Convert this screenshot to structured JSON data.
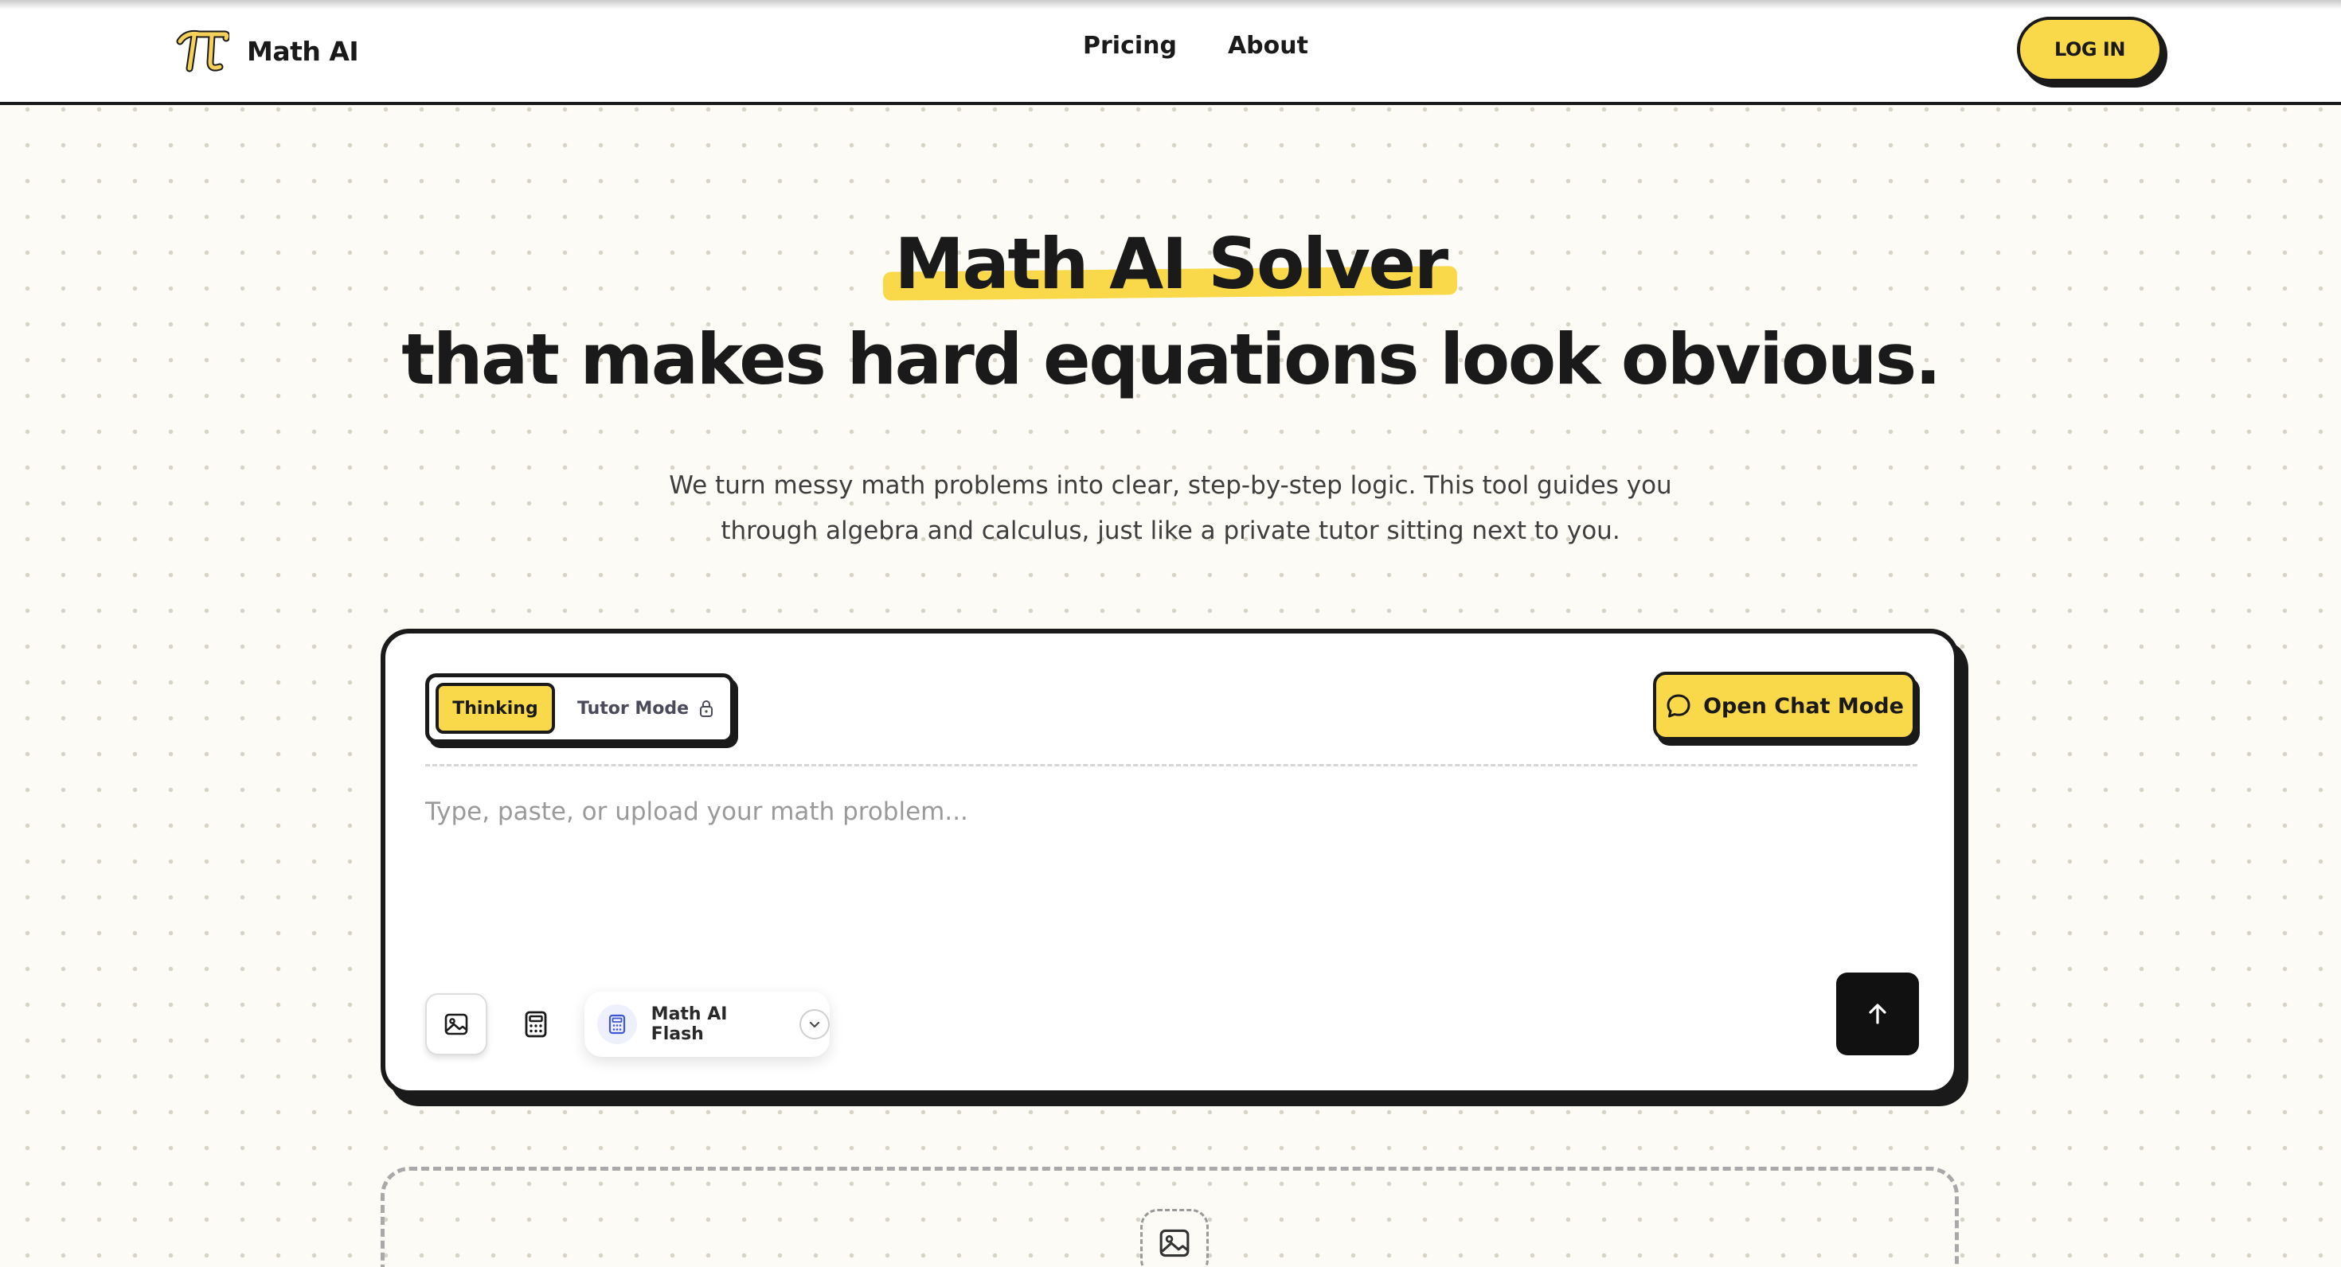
{
  "header": {
    "brand_name": "Math AI",
    "nav": [
      {
        "label": "Pricing"
      },
      {
        "label": "About"
      }
    ],
    "login_label": "LOG IN"
  },
  "hero": {
    "title_highlight": "Math AI Solver",
    "title_rest": "that makes hard equations look obvious.",
    "subtitle_line1": "We turn messy math problems into clear, step-by-step logic. This tool guides you",
    "subtitle_line2": "through algebra and calculus, just like a private tutor sitting next to you."
  },
  "solver": {
    "modes": [
      {
        "label": "Thinking",
        "active": true
      },
      {
        "label": "Tutor Mode",
        "locked": true
      }
    ],
    "open_chat_label": "Open Chat Mode",
    "input_placeholder": "Type, paste, or upload your math problem...",
    "input_value": "",
    "model_label": "Math AI Flash"
  },
  "colors": {
    "accent_yellow": "#f9d94a",
    "ink": "#1a1a1a",
    "background": "#fcfbf6"
  },
  "icons": [
    "pi-logo-icon",
    "lock-icon",
    "chat-bubble-icon",
    "image-icon",
    "calculator-icon",
    "chevron-down-icon",
    "arrow-up-icon"
  ]
}
